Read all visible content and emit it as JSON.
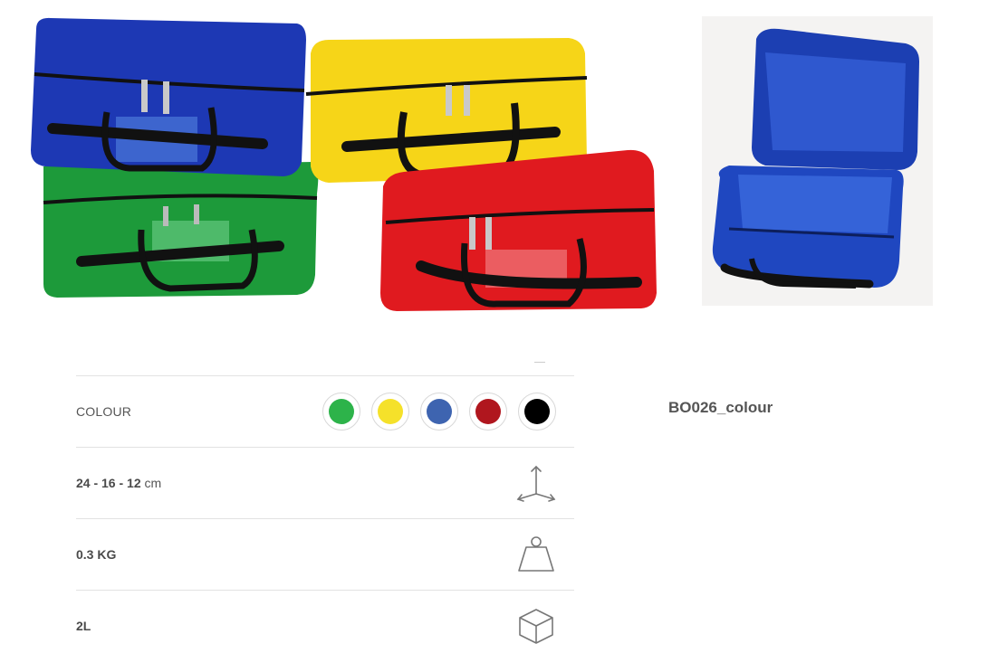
{
  "specs": {
    "colour_label": "COLOUR",
    "swatches": [
      {
        "name": "green",
        "color": "#2db34a"
      },
      {
        "name": "yellow",
        "color": "#f5e12a"
      },
      {
        "name": "blue",
        "color": "#3e64b0"
      },
      {
        "name": "red",
        "color": "#b0161e"
      },
      {
        "name": "black",
        "color": "#000000"
      }
    ],
    "dimensions_value": "24 - 16 - 12",
    "dimensions_unit": "cm",
    "dimensions_icon": "axes-3d-icon",
    "weight_value": "0.3 KG",
    "weight_icon": "weight-icon",
    "volume_value": "2L",
    "volume_icon": "cube-icon"
  },
  "sku": "BO026_colour"
}
